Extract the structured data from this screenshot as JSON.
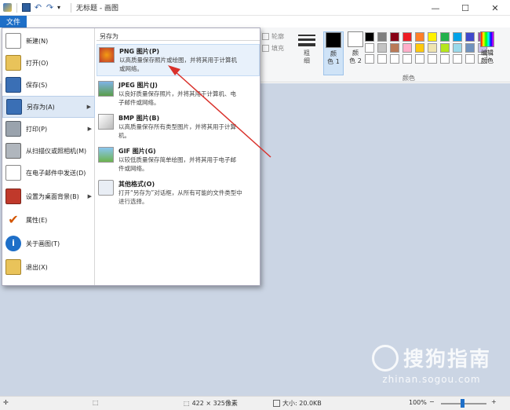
{
  "window": {
    "title": "无标题 - 画图",
    "controls": [
      "—",
      "☐",
      "✕"
    ]
  },
  "ribbon": {
    "file_tab": "文件",
    "outline_label": "轮廓",
    "fill_label": "填充",
    "stroke_label_1": "粗",
    "stroke_label_2": "细",
    "color1_line1": "颜",
    "color1_line2": "色 1",
    "color2_line1": "颜",
    "color2_line2": "色 2",
    "edit_colors_line1": "编辑",
    "edit_colors_line2": "颜色",
    "group_colors": "颜色",
    "color1_value": "#000000",
    "color2_value": "#ffffff",
    "palette": [
      "#000000",
      "#7f7f7f",
      "#880015",
      "#ed1c24",
      "#ff7f27",
      "#fff200",
      "#22b14c",
      "#00a2e8",
      "#3f48cc",
      "#a349a4",
      "#ffffff",
      "#c3c3c3",
      "#b97a57",
      "#ffaec9",
      "#ffc90e",
      "#efe4b0",
      "#b5e61d",
      "#99d9ea",
      "#7092be",
      "#c8bfe7",
      "#ffffff",
      "#ffffff",
      "#ffffff",
      "#ffffff",
      "#ffffff",
      "#ffffff",
      "#ffffff",
      "#ffffff",
      "#ffffff",
      "#ffffff"
    ]
  },
  "file_menu": {
    "items": [
      {
        "label": "新建(N)",
        "icon": "new-doc-icon"
      },
      {
        "label": "打开(O)",
        "icon": "open-folder-icon"
      },
      {
        "label": "保存(S)",
        "icon": "save-icon"
      },
      {
        "label": "另存为(A)",
        "icon": "save-as-icon"
      },
      {
        "label": "打印(P)",
        "icon": "printer-icon"
      },
      {
        "label": "从扫描仪或照相机(M)",
        "icon": "scanner-icon"
      },
      {
        "label": "在电子邮件中发送(D)",
        "icon": "email-icon"
      },
      {
        "label": "设置为桌面背景(B)",
        "icon": "desktop-icon"
      },
      {
        "label": "属性(E)",
        "icon": "checkmark-icon"
      },
      {
        "label": "关于画图(T)",
        "icon": "info-icon"
      },
      {
        "label": "退出(X)",
        "icon": "exit-icon"
      }
    ],
    "save_as_panel": {
      "title": "另存为",
      "formats": [
        {
          "name": "PNG 图片(P)",
          "desc_1": "以高质量保存照片或绘图，并将其用于计算机",
          "desc_2": "或网络。"
        },
        {
          "name": "JPEG 图片(J)",
          "desc_1": "以良好质量保存照片，并将其用于计算机、电",
          "desc_2": "子邮件或网络。"
        },
        {
          "name": "BMP 图片(B)",
          "desc_1": "以高质量保存所有类型图片，并将其用于计算",
          "desc_2": "机。"
        },
        {
          "name": "GIF 图片(G)",
          "desc_1": "以较低质量保存简单绘图，并将其用于电子邮",
          "desc_2": "件或网络。"
        },
        {
          "name": "其他格式(O)",
          "desc_1": "打开“另存为”对话框，从所有可能的文件类型中",
          "desc_2": "进行选择。"
        }
      ]
    }
  },
  "watermark": {
    "main": "搜狗指南",
    "sub": "zhinan.sogou.com"
  },
  "statusbar": {
    "dimensions": "422 × 325像素",
    "size": "大小: 20.0KB",
    "zoom": "100%",
    "zoom_out": "−",
    "zoom_in": "+"
  }
}
